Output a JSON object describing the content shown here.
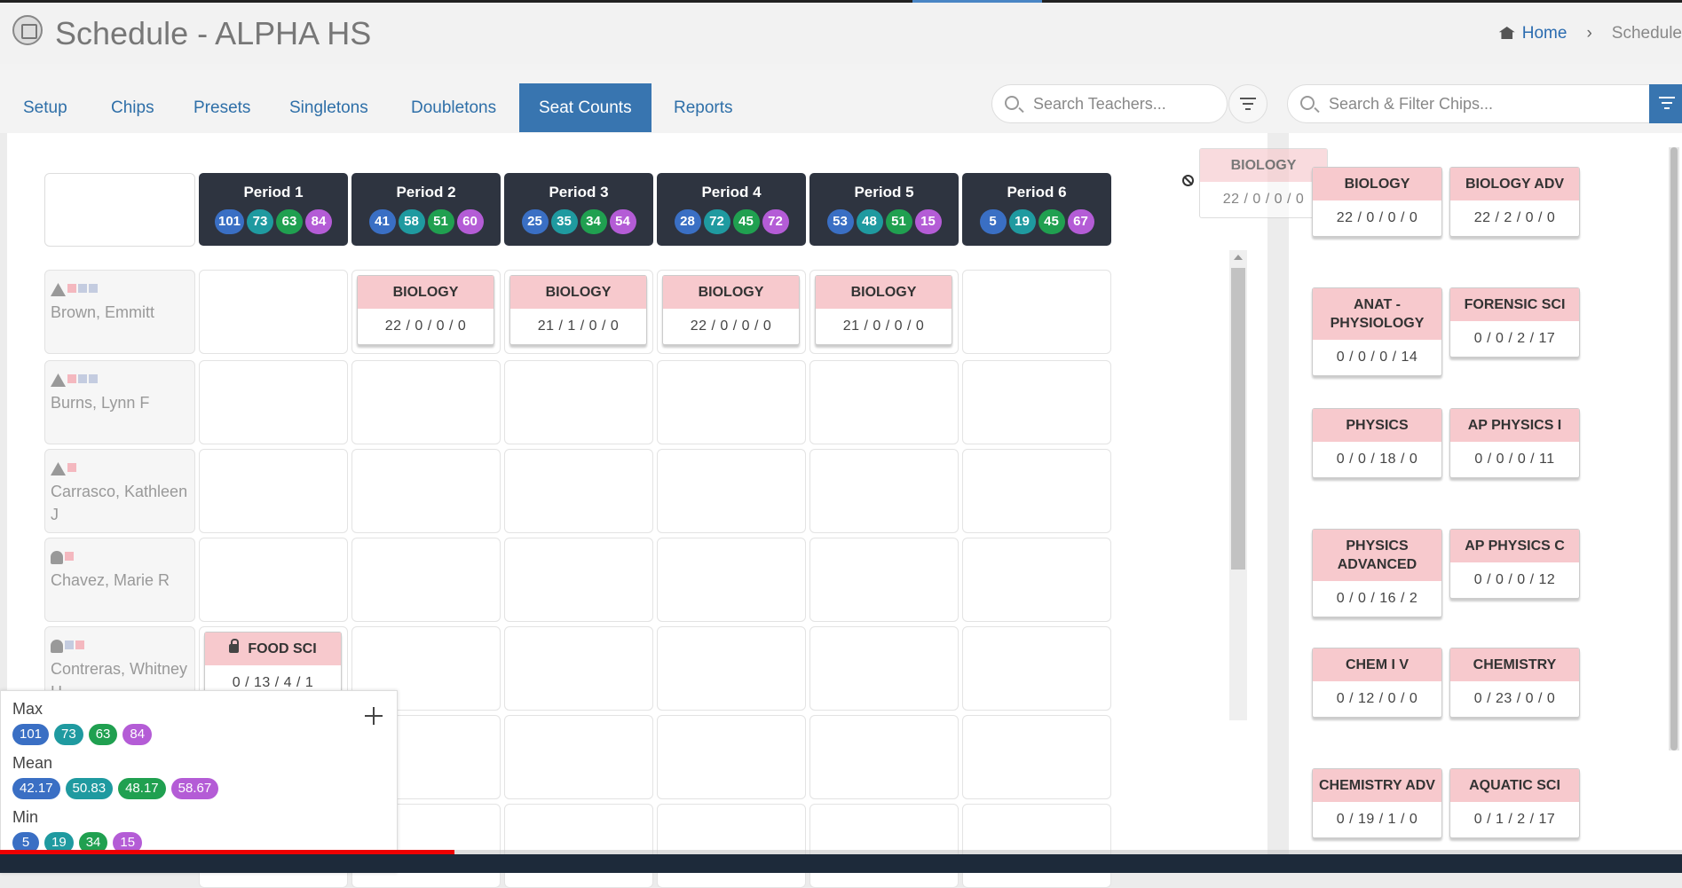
{
  "header": {
    "title": "Schedule - ALPHA HS",
    "breadcrumb": {
      "home": "Home",
      "separator": "›",
      "current": "Schedule"
    }
  },
  "nav": {
    "tabs": [
      "Setup",
      "Chips",
      "Presets",
      "Singletons",
      "Doubletons",
      "Seat Counts",
      "Reports"
    ],
    "active_tab": "Seat Counts",
    "teacher_search_placeholder": "Search Teachers...",
    "chip_search_placeholder": "Search & Filter Chips..."
  },
  "periods": [
    {
      "label": "Period 1",
      "counts": [
        101,
        73,
        63,
        84
      ]
    },
    {
      "label": "Period 2",
      "counts": [
        41,
        58,
        51,
        60
      ]
    },
    {
      "label": "Period 3",
      "counts": [
        25,
        35,
        34,
        54
      ]
    },
    {
      "label": "Period 4",
      "counts": [
        28,
        72,
        45,
        72
      ]
    },
    {
      "label": "Period 5",
      "counts": [
        53,
        48,
        51,
        15
      ]
    },
    {
      "label": "Period 6",
      "counts": [
        5,
        19,
        45,
        67
      ]
    }
  ],
  "count_colors": [
    "#3a6fc4",
    "#1f9aa0",
    "#20a050",
    "#b45cd6"
  ],
  "teachers": [
    {
      "name": "Brown, Emmitt",
      "icon": "warning-icon",
      "flags": [
        "pink",
        "gray",
        "gray"
      ]
    },
    {
      "name": "Burns, Lynn F",
      "icon": "warning-icon",
      "flags": [
        "pink",
        "gray",
        "gray"
      ]
    },
    {
      "name": "Carrasco, Kathleen J",
      "icon": "warning-icon",
      "flags": [
        "pink"
      ]
    },
    {
      "name": "Chavez, Marie R",
      "icon": "user-icon",
      "flags": [
        "pink"
      ]
    },
    {
      "name": "Contreras, Whitney H",
      "icon": "user-icon",
      "flags": [
        "gray",
        "pink"
      ]
    }
  ],
  "scheduled_chips": [
    {
      "teacher": "Brown, Emmitt",
      "period": 2,
      "title": "BIOLOGY",
      "counts": "22 / 0 / 0 / 0"
    },
    {
      "teacher": "Brown, Emmitt",
      "period": 3,
      "title": "BIOLOGY",
      "counts": "21 / 1 / 0 / 0"
    },
    {
      "teacher": "Brown, Emmitt",
      "period": 4,
      "title": "BIOLOGY",
      "counts": "22 / 0 / 0 / 0"
    },
    {
      "teacher": "Brown, Emmitt",
      "period": 5,
      "title": "BIOLOGY",
      "counts": "21 / 0 / 0 / 0"
    },
    {
      "teacher": "Contreras, Whitney H",
      "period": 1,
      "title": "FOOD SCI",
      "counts": "0 / 13 / 4 / 1",
      "locked": true
    }
  ],
  "dragging_chip": {
    "title": "BIOLOGY",
    "counts": "22 / 0 / 0 / 0"
  },
  "chip_palette": [
    {
      "title": "BIOLOGY",
      "counts": "22 / 0 / 0 / 0"
    },
    {
      "title": "BIOLOGY ADV",
      "counts": "22 / 2 / 0 / 0"
    },
    {
      "title": "ANAT - PHYSIOLOGY",
      "counts": "0 / 0 / 0 / 14"
    },
    {
      "title": "FORENSIC SCI",
      "counts": "0 / 0 / 2 / 17"
    },
    {
      "title": "PHYSICS",
      "counts": "0 / 0 / 18 / 0"
    },
    {
      "title": "AP PHYSICS I",
      "counts": "0 / 0 / 0 / 11"
    },
    {
      "title": "PHYSICS ADVANCED",
      "counts": "0 / 0 / 16 / 2"
    },
    {
      "title": "AP PHYSICS C",
      "counts": "0 / 0 / 0 / 12"
    },
    {
      "title": "CHEM I V",
      "counts": "0 / 12 / 0 / 0"
    },
    {
      "title": "CHEMISTRY",
      "counts": "0 / 23 / 0 / 0"
    },
    {
      "title": "CHEMISTRY ADV",
      "counts": "0 / 19 / 1 / 0"
    },
    {
      "title": "AQUATIC SCI",
      "counts": "0 / 1 / 2 / 17"
    }
  ],
  "stats": {
    "max_label": "Max",
    "max": [
      "101",
      "73",
      "63",
      "84"
    ],
    "mean_label": "Mean",
    "mean": [
      "42.17",
      "50.83",
      "48.17",
      "58.67"
    ],
    "min_label": "Min",
    "min": [
      "5",
      "19",
      "34",
      "15"
    ]
  },
  "video_progress": 0.27
}
